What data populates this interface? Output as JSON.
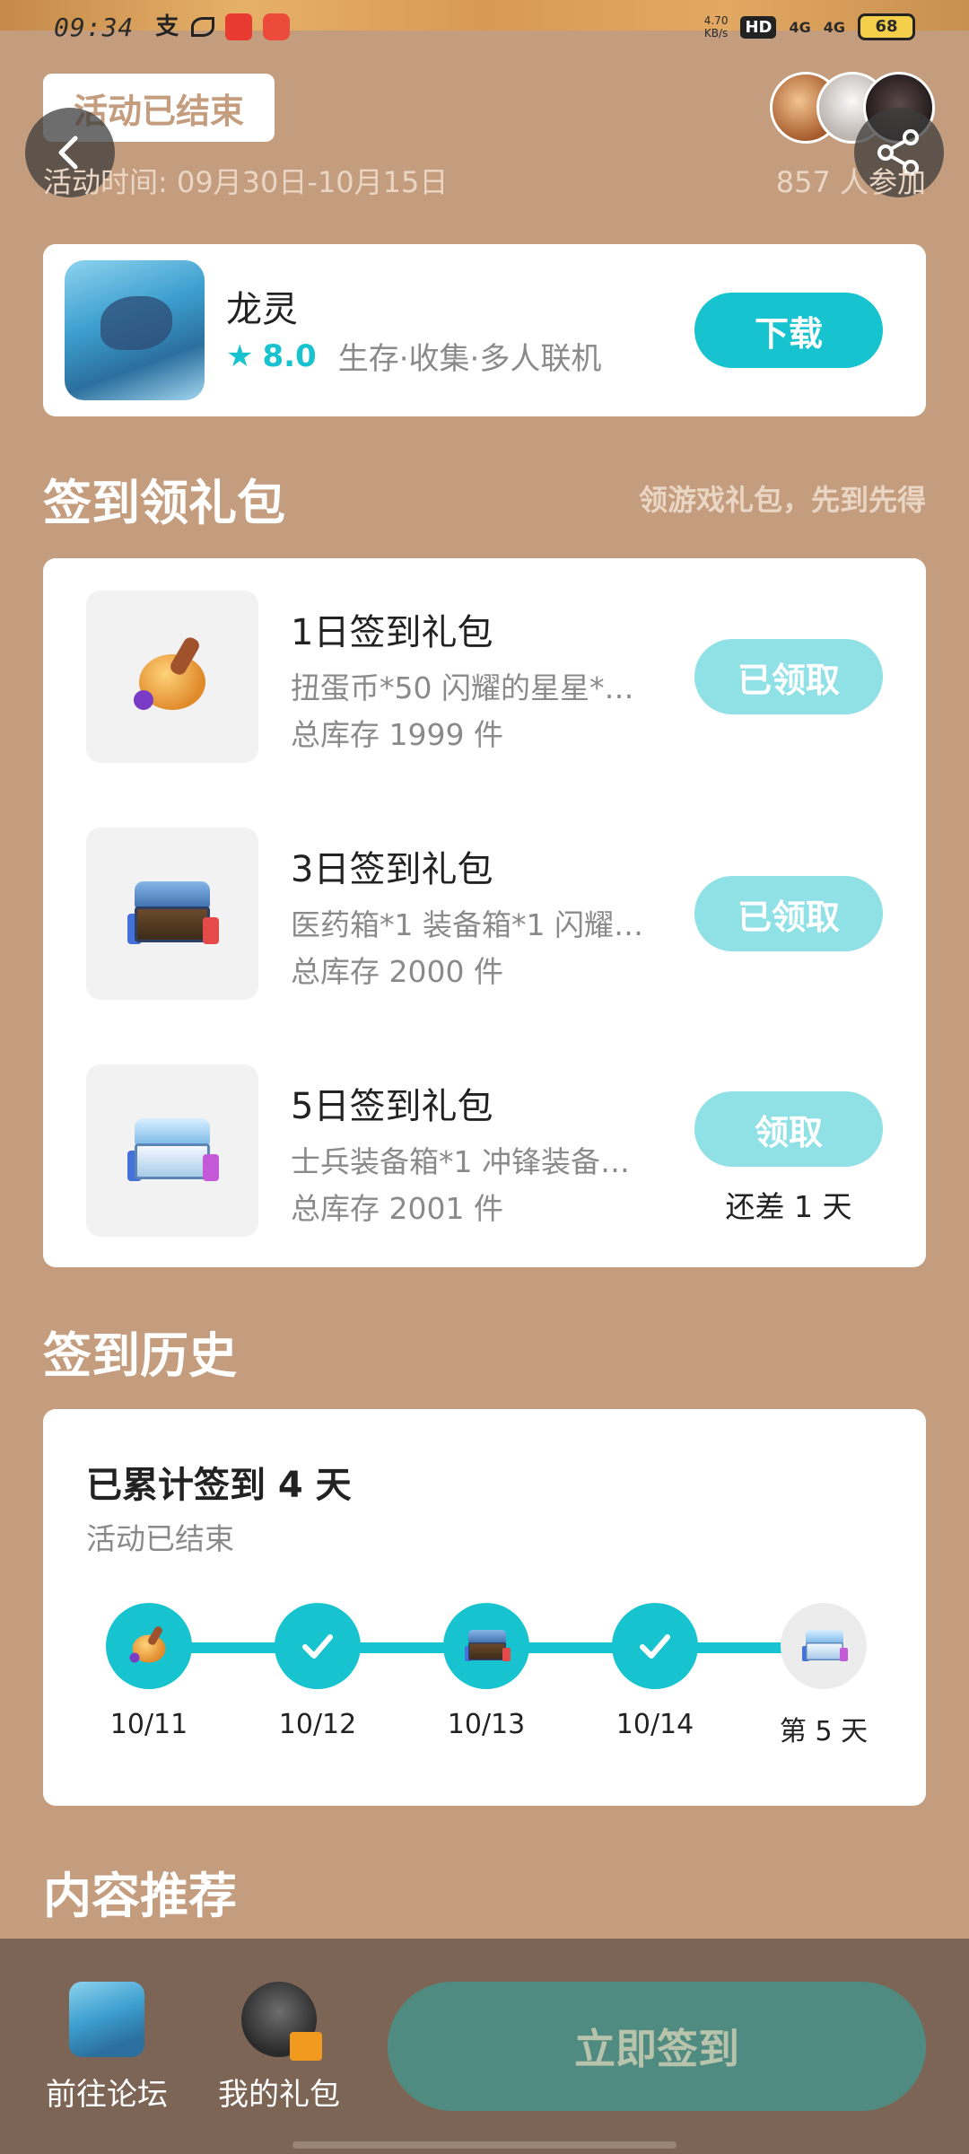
{
  "status_bar": {
    "time": "09:34",
    "speed_value": "4.70",
    "speed_unit": "KB/s",
    "hd": "HD",
    "sim1": "4G",
    "sim2": "4G",
    "battery": "68"
  },
  "header": {
    "ended_badge": "活动已结束",
    "activity_time": "活动时间: 09月30日-10月15日",
    "participants": "857 人参加"
  },
  "game": {
    "name": "龙灵",
    "rating": "8.0",
    "tags": "生存·收集·多人联机",
    "download_label": "下载"
  },
  "gift_section": {
    "title": "签到领礼包",
    "subtitle": "领游戏礼包，先到先得",
    "items": [
      {
        "name": "1日签到礼包",
        "desc": "扭蛋币*50 闪耀的星星*…",
        "stock": "总库存 1999 件",
        "button": "已领取",
        "icon": "pot-gift-icon"
      },
      {
        "name": "3日签到礼包",
        "desc": "医药箱*1 装备箱*1 闪耀…",
        "stock": "总库存 2000 件",
        "button": "已领取",
        "icon": "chest-gift-icon"
      },
      {
        "name": "5日签到礼包",
        "desc": "士兵装备箱*1 冲锋装备…",
        "stock": "总库存 2001 件",
        "button": "领取",
        "remain": "还差 1 天",
        "icon": "white-chest-gift-icon"
      }
    ]
  },
  "history": {
    "section_title": "签到历史",
    "title": "已累计签到 4 天",
    "subtitle": "活动已结束",
    "days": [
      "10/11",
      "10/12",
      "10/13",
      "10/14",
      "第 5 天"
    ]
  },
  "recommend": {
    "title": "内容推荐"
  },
  "bottom_bar": {
    "forum_label": "前往论坛",
    "my_gifts_label": "我的礼包",
    "signin_label": "立即签到"
  },
  "colors": {
    "background": "#c49d7e",
    "accent": "#17c3cf",
    "accent_light": "#8fe1e6",
    "bottom_bar": "#7d6555",
    "signin_button": "#4f8b80"
  }
}
